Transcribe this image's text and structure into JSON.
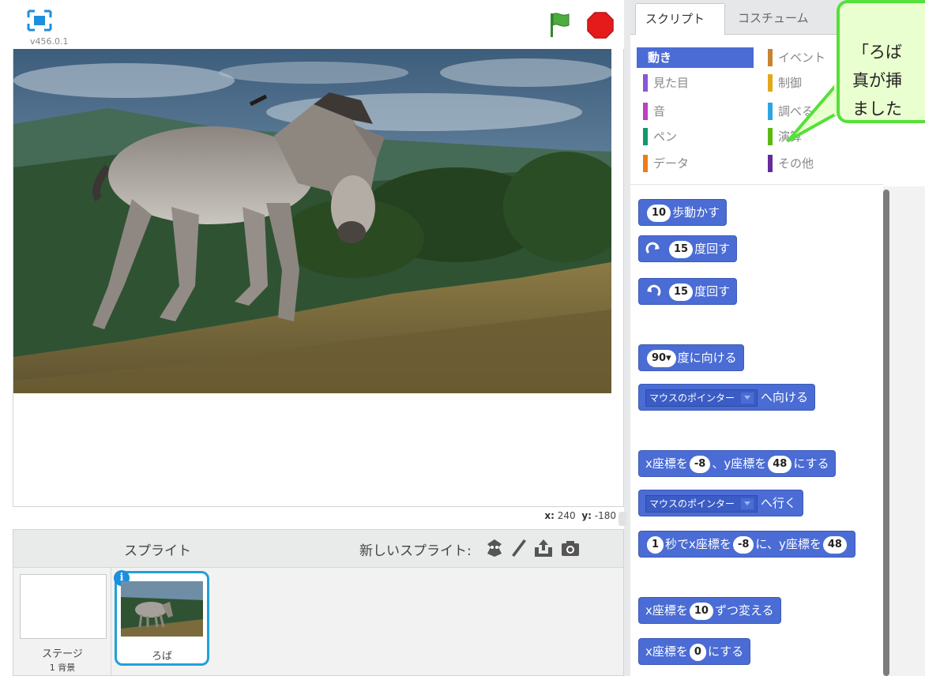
{
  "stage": {
    "version": "v456.0.1",
    "coords": {
      "x_label": "x:",
      "x_value": "240",
      "y_label": "y:",
      "y_value": "-180"
    }
  },
  "sprite_pane": {
    "title": "スプライト",
    "new_sprite_label": "新しいスプライト:",
    "new_sprite_icons": [
      "sprite-library-icon",
      "paint-brush-icon",
      "upload-icon",
      "camera-icon"
    ],
    "stage": {
      "label": "ステージ",
      "backdrop_count": "1 背景"
    },
    "sprites": [
      {
        "name": "ろば",
        "info_glyph": "i"
      }
    ]
  },
  "tabs": [
    "スクリプト",
    "コスチューム"
  ],
  "categories": [
    {
      "label": "動き",
      "color": "#4a6cd4",
      "selected": true
    },
    {
      "label": "イベント",
      "color": "#c88330"
    },
    {
      "label": "見た目",
      "color": "#8a55d7"
    },
    {
      "label": "制御",
      "color": "#e1a91a"
    },
    {
      "label": "音",
      "color": "#bb42c3"
    },
    {
      "label": "調べる",
      "color": "#2ca5e2"
    },
    {
      "label": "ペン",
      "color": "#0e9a6c"
    },
    {
      "label": "演算",
      "color": "#5cb712"
    },
    {
      "label": "データ",
      "color": "#ee7d16"
    },
    {
      "label": "その他",
      "color": "#632d99"
    }
  ],
  "blocks": {
    "move": {
      "value": "10",
      "text": "歩動かす"
    },
    "turn_right": {
      "value": "15",
      "text": "度回す"
    },
    "turn_left": {
      "value": "15",
      "text": "度回す"
    },
    "point_dir": {
      "value": "90▾",
      "text": "度に向ける"
    },
    "point_towards": {
      "dropdown": "マウスのポインター",
      "text": "へ向ける"
    },
    "goto_xy": {
      "t1": "x座標を",
      "x": "-8",
      "t2": "、y座標を",
      "y": "48",
      "t3": "にする"
    },
    "goto": {
      "dropdown": "マウスのポインター",
      "text": "へ行く"
    },
    "glide": {
      "secs": "1",
      "t1": "秒でx座標を",
      "x": "-8",
      "t2": "に、y座標を",
      "y": "48"
    },
    "change_x": {
      "t1": "x座標を",
      "value": "10",
      "t2": "ずつ変える"
    },
    "set_x": {
      "t1": "x座標を",
      "value": "0",
      "t2": "にする"
    }
  },
  "callout": {
    "text": "「ろば\n真が挿\nました"
  },
  "colors": {
    "motion": "#4a6cd4",
    "callout_border": "#55e03a",
    "callout_fill": "#eaffcf",
    "selected_outline": "#22a0d8"
  }
}
